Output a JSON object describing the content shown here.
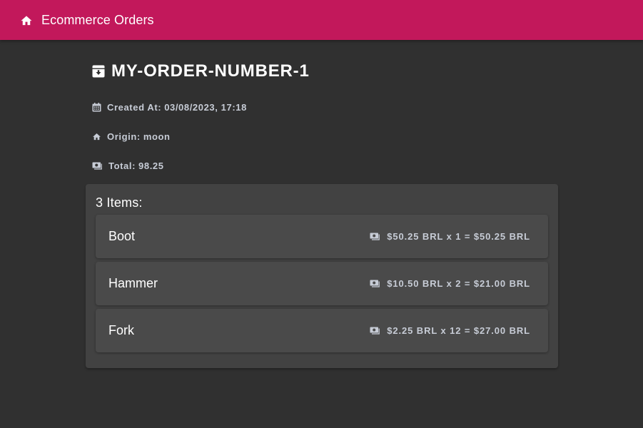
{
  "app_bar": {
    "title": "Ecommerce Orders",
    "home_icon": "home-icon",
    "color": "#c2185b"
  },
  "order": {
    "number": "MY-ORDER-NUMBER-1",
    "title_icon": "archive-box-icon",
    "created_label": "Created At:",
    "created_value": "03/08/2023, 17:18",
    "origin_label": "Origin:",
    "origin_value": "moon",
    "total_label": "Total:",
    "total_value": "98.25"
  },
  "items_section": {
    "heading": "3 Items:",
    "items": [
      {
        "name": "Boot",
        "price_line": "$50.25 BRL x 1 = $50.25 BRL"
      },
      {
        "name": "Hammer",
        "price_line": "$10.50 BRL x 2 = $21.00 BRL"
      },
      {
        "name": "Fork",
        "price_line": "$2.25 BRL x 12 = $27.00 BRL"
      }
    ]
  },
  "colors": {
    "background": "#303030",
    "card": "#424242",
    "item": "#4a4a4a",
    "muted_text": "#c7ccd6"
  }
}
